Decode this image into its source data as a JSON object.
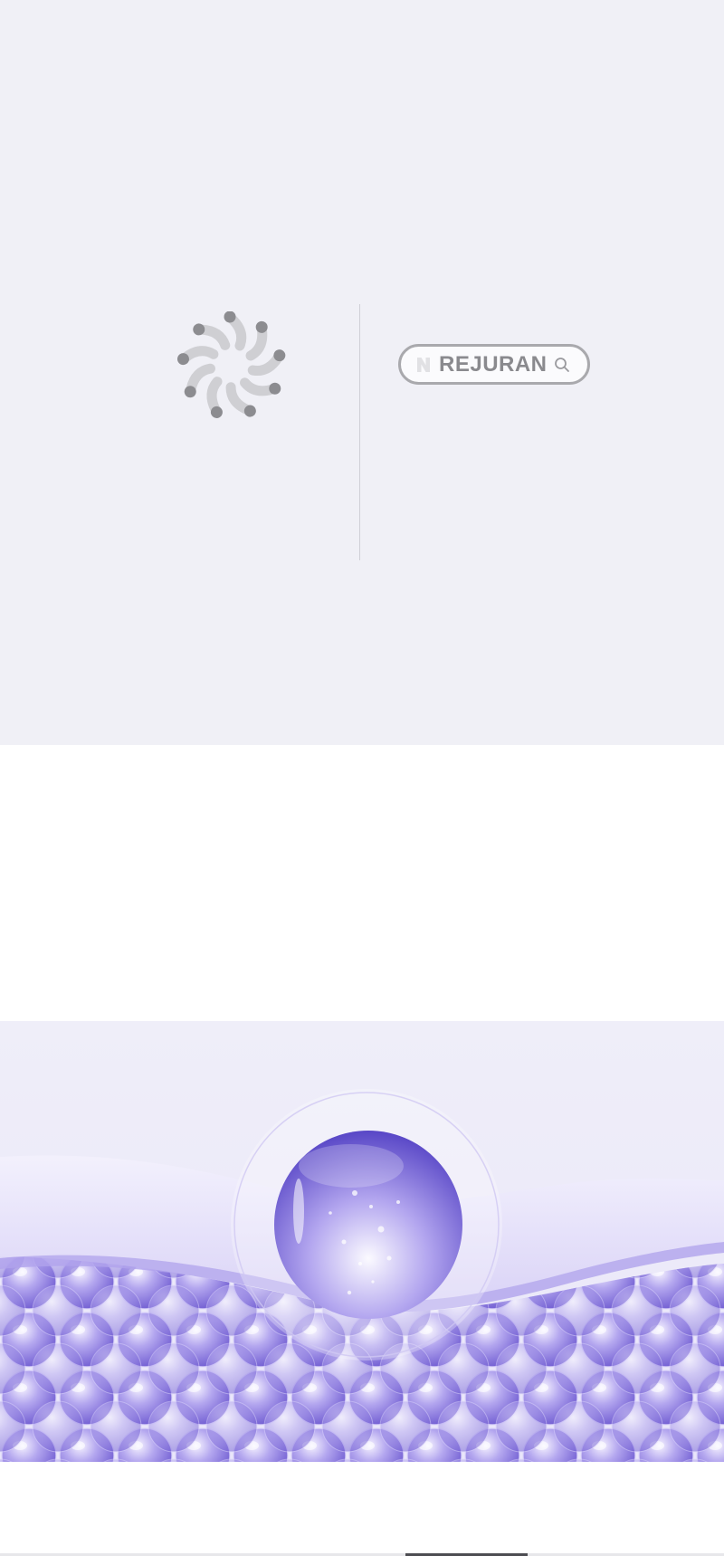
{
  "brand": {
    "name": "REJURAN",
    "naver_badge": "N"
  },
  "colors": {
    "hero_background": "#f0f0f6",
    "logo_dark": "#8c8c90",
    "logo_light": "#cfcfd3",
    "pill_border": "#a9a9ad",
    "text_gray": "#8a8a8e",
    "bubble_purple": "#7c6ad6",
    "sky_lavender": "#eeedf8"
  },
  "icons": {
    "logo": "rejuran-molecule-logo-icon",
    "search": "search-icon",
    "badge": "naver-n-icon"
  }
}
